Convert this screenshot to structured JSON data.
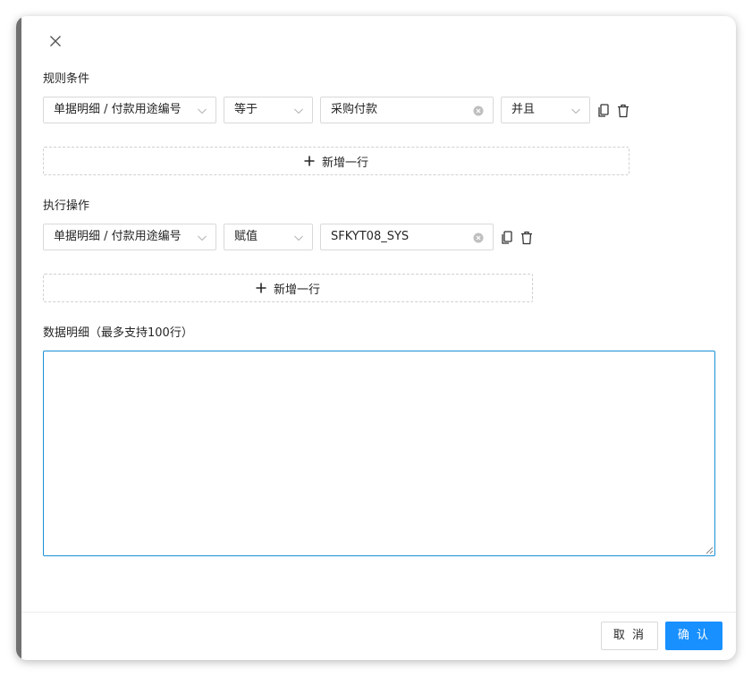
{
  "dialog": {
    "rule_conditions": {
      "title": "规则条件",
      "field_select": "单据明细 / 付款用途编号",
      "operator_select": "等于",
      "value_input": "采购付款",
      "logic_select": "并且",
      "add_row_label": "新增一行"
    },
    "actions": {
      "title": "执行操作",
      "field_select": "单据明细 / 付款用途编号",
      "operator_select": "赋值",
      "value_input": "SFKYT08_SYS",
      "add_row_label": "新增一行"
    },
    "data_detail": {
      "title": "数据明细（最多支持100行）",
      "textarea_value": ""
    },
    "footer": {
      "cancel_label": "取 消",
      "confirm_label": "确 认"
    }
  },
  "colors": {
    "primary": "#1890ff",
    "focus_border": "#1a8fd6",
    "border": "#d9d9d9"
  },
  "icons": [
    "close-icon",
    "chevron-down-icon",
    "clear-circle-icon",
    "copy-icon",
    "trash-icon",
    "plus-icon"
  ]
}
